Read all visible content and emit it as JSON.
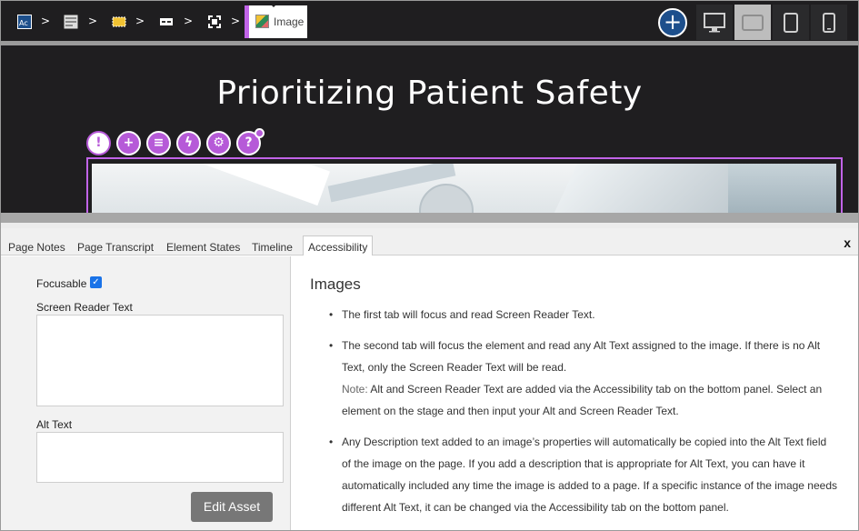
{
  "toolbar": {
    "breadcrumbs": [
      {
        "icon": "course-icon",
        "sep": ">"
      },
      {
        "icon": "page-icon",
        "sep": ">"
      },
      {
        "icon": "section-icon",
        "sep": ">"
      },
      {
        "icon": "row-icon",
        "sep": ">"
      },
      {
        "icon": "container-icon",
        "sep": ">"
      }
    ],
    "active_crumb": "Image",
    "add_label": "+",
    "devices": [
      "desktop",
      "tablet-landscape",
      "tablet-portrait",
      "phone"
    ],
    "active_device": "tablet-landscape"
  },
  "stage": {
    "title": "Prioritizing Patient Safety",
    "tools": [
      {
        "name": "accessibility-tool",
        "glyph": "!"
      },
      {
        "name": "add-tool",
        "glyph": "+"
      },
      {
        "name": "properties-tool",
        "glyph": "≡"
      },
      {
        "name": "actions-tool",
        "glyph": "ϟ"
      },
      {
        "name": "settings-tool",
        "glyph": "⚙"
      },
      {
        "name": "help-tool",
        "glyph": "?"
      }
    ]
  },
  "panel": {
    "tabs": [
      "Page Notes",
      "Page Transcript",
      "Element States",
      "Timeline",
      "Accessibility"
    ],
    "active_tab": "Accessibility",
    "close": "x",
    "left": {
      "focusable_label": "Focusable",
      "focusable_checked": true,
      "screen_reader_label": "Screen Reader Text",
      "screen_reader_value": "",
      "alt_text_label": "Alt Text",
      "alt_text_value": "",
      "edit_asset_label": "Edit Asset"
    },
    "right": {
      "title": "Images",
      "items": [
        {
          "text": "The first tab will focus and read Screen Reader Text."
        },
        {
          "text": "The second tab will focus the element and read any Alt Text assigned to the image. If there is no Alt Text, only the Screen Reader Text will be read.",
          "note_label": "Note:",
          "note": "Alt and Screen Reader Text are added via the Accessibility tab on the bottom panel. Select an element on the stage and then input your Alt and Screen Reader Text."
        },
        {
          "text": "Any Description text added to an image’s properties will automatically be copied into the Alt Text field of the image on the page. If you add a description that is appropriate for Alt Text, you can have it automatically included any time the image is added to a page. If a specific instance of the image needs different Alt Text, it can be changed via the Accessibility tab on the bottom panel."
        }
      ]
    }
  }
}
